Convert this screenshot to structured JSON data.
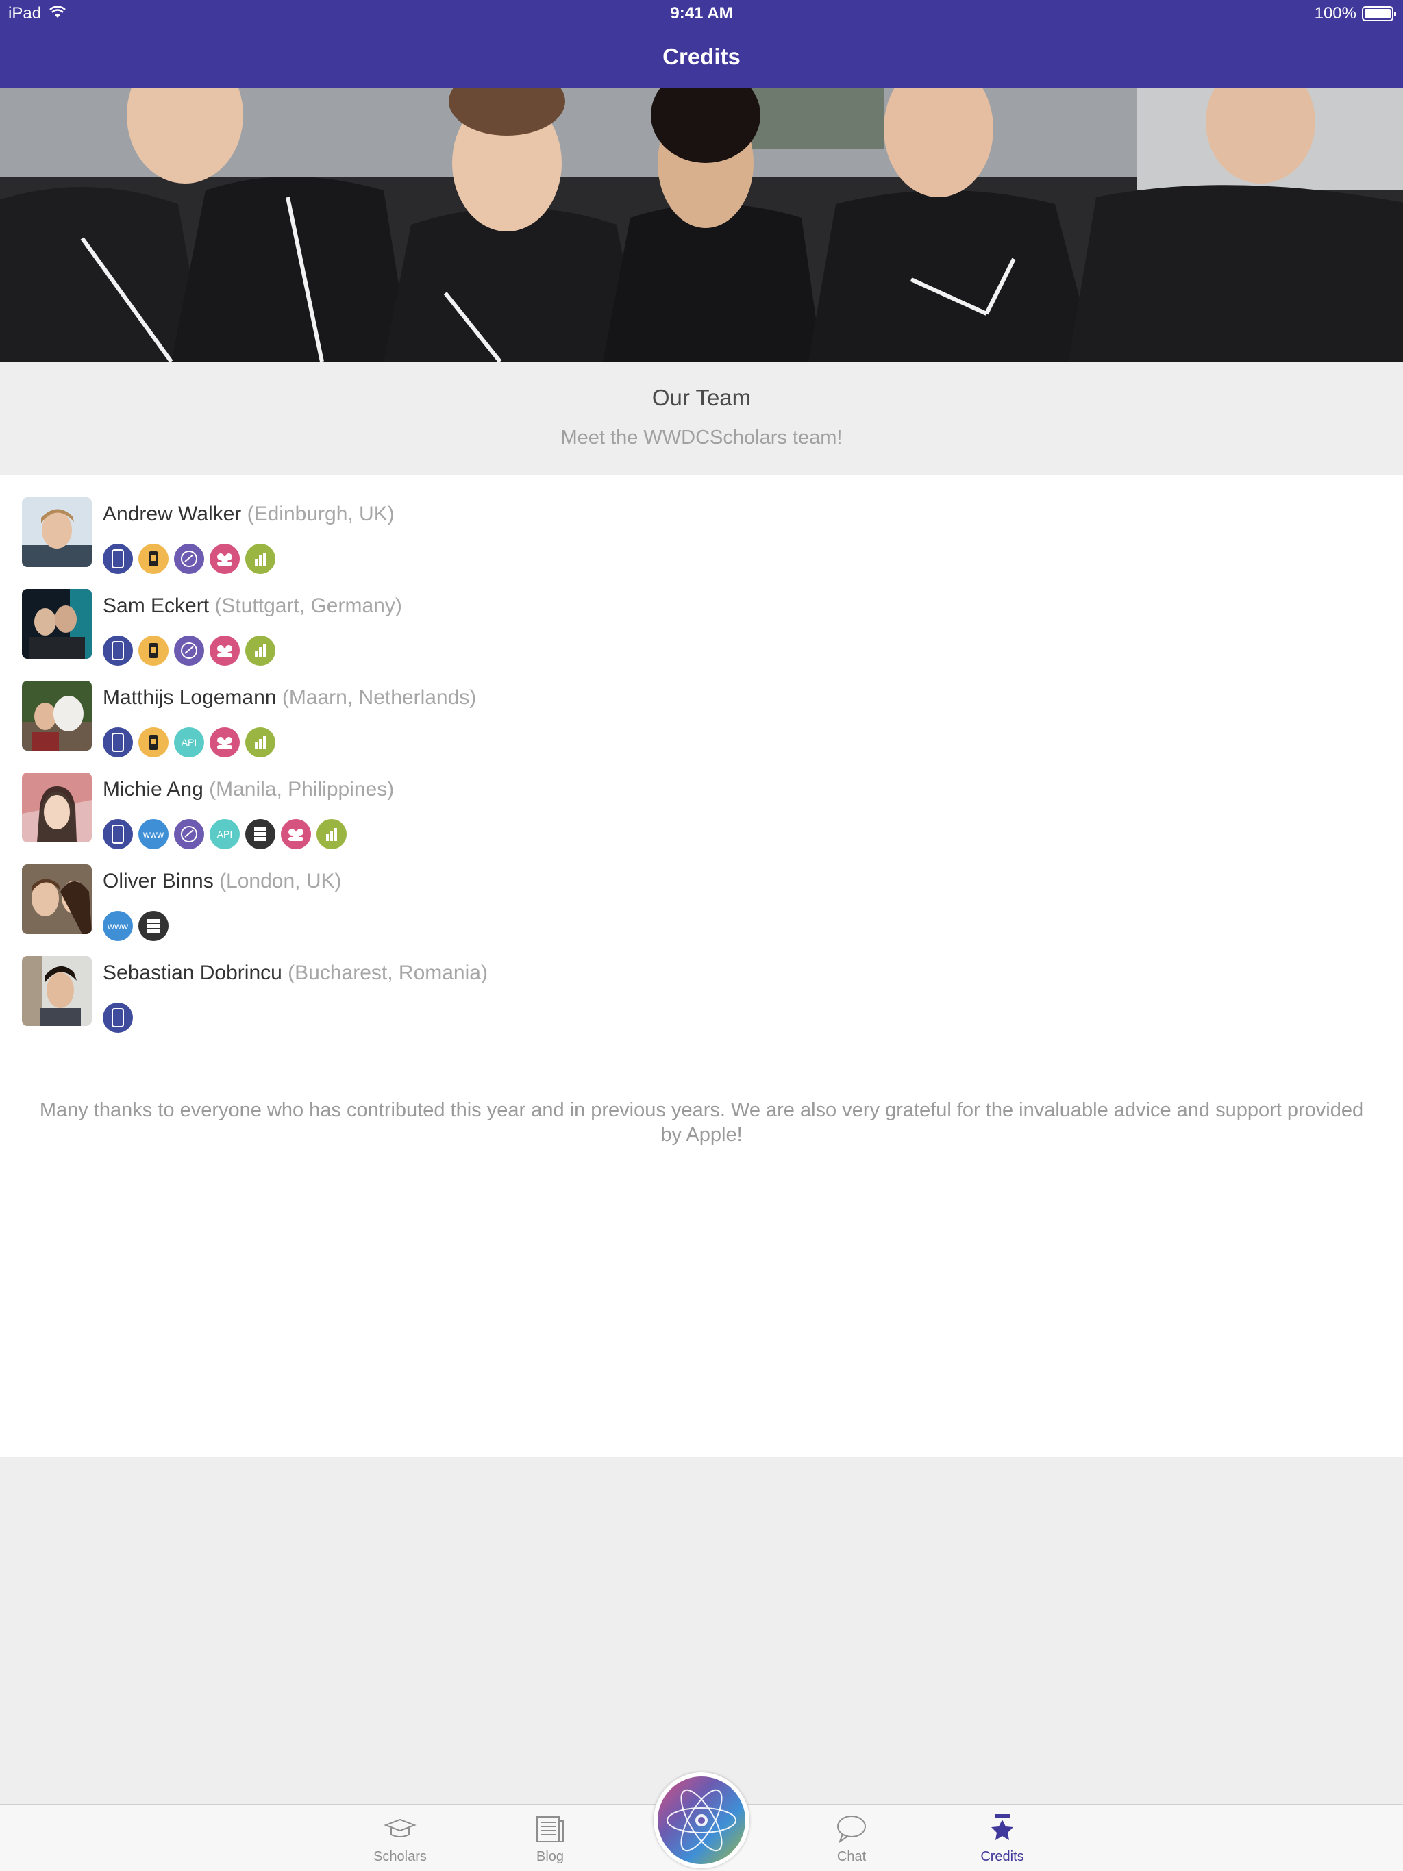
{
  "status_bar": {
    "device": "iPad",
    "time": "9:41 AM",
    "battery": "100%"
  },
  "nav": {
    "title": "Credits"
  },
  "hero": {
    "alt": "team-photo"
  },
  "section": {
    "title": "Our Team",
    "subtitle": "Meet the WWDCScholars team!"
  },
  "members": [
    {
      "name": "Andrew Walker",
      "location": "(Edinburgh, UK)",
      "roles": [
        "ios-app",
        "watch-app",
        "design",
        "community",
        "analytics"
      ]
    },
    {
      "name": "Sam Eckert",
      "location": "(Stuttgart, Germany)",
      "roles": [
        "ios-app",
        "watch-app",
        "design",
        "community",
        "analytics"
      ]
    },
    {
      "name": "Matthijs Logemann",
      "location": "(Maarn, Netherlands)",
      "roles": [
        "ios-app",
        "watch-app",
        "api",
        "community",
        "analytics"
      ]
    },
    {
      "name": "Michie Ang",
      "location": "(Manila, Philippines)",
      "roles": [
        "ios-app",
        "web",
        "design",
        "api",
        "server",
        "community",
        "analytics"
      ]
    },
    {
      "name": "Oliver Binns",
      "location": "(London, UK)",
      "roles": [
        "web",
        "server"
      ]
    },
    {
      "name": "Sebastian Dobrincu",
      "location": "(Bucharest, Romania)",
      "roles": [
        "ios-app"
      ]
    }
  ],
  "badge_labels": {
    "web": "www",
    "api": "API"
  },
  "badge_colors": {
    "ios-app": "#3f4c9e",
    "watch-app": "#f0b84e",
    "design": "#6c5bb0",
    "community": "#d6527f",
    "analytics": "#9bb542",
    "api": "#5bcbc8",
    "web": "#3f8fd6",
    "server": "#333333"
  },
  "thanks": "Many thanks to everyone who has contributed this year and in previous years. We are also very grateful for the invaluable advice and support provided by Apple!",
  "tabs": [
    {
      "label": "Scholars",
      "icon": "graduation-cap-icon",
      "active": false
    },
    {
      "label": "Blog",
      "icon": "newspaper-icon",
      "active": false
    },
    {
      "label": "Chat",
      "icon": "chat-bubble-icon",
      "active": false
    },
    {
      "label": "Credits",
      "icon": "medal-star-icon",
      "active": true
    }
  ],
  "center_button": {
    "icon": "atom-logo-icon"
  }
}
